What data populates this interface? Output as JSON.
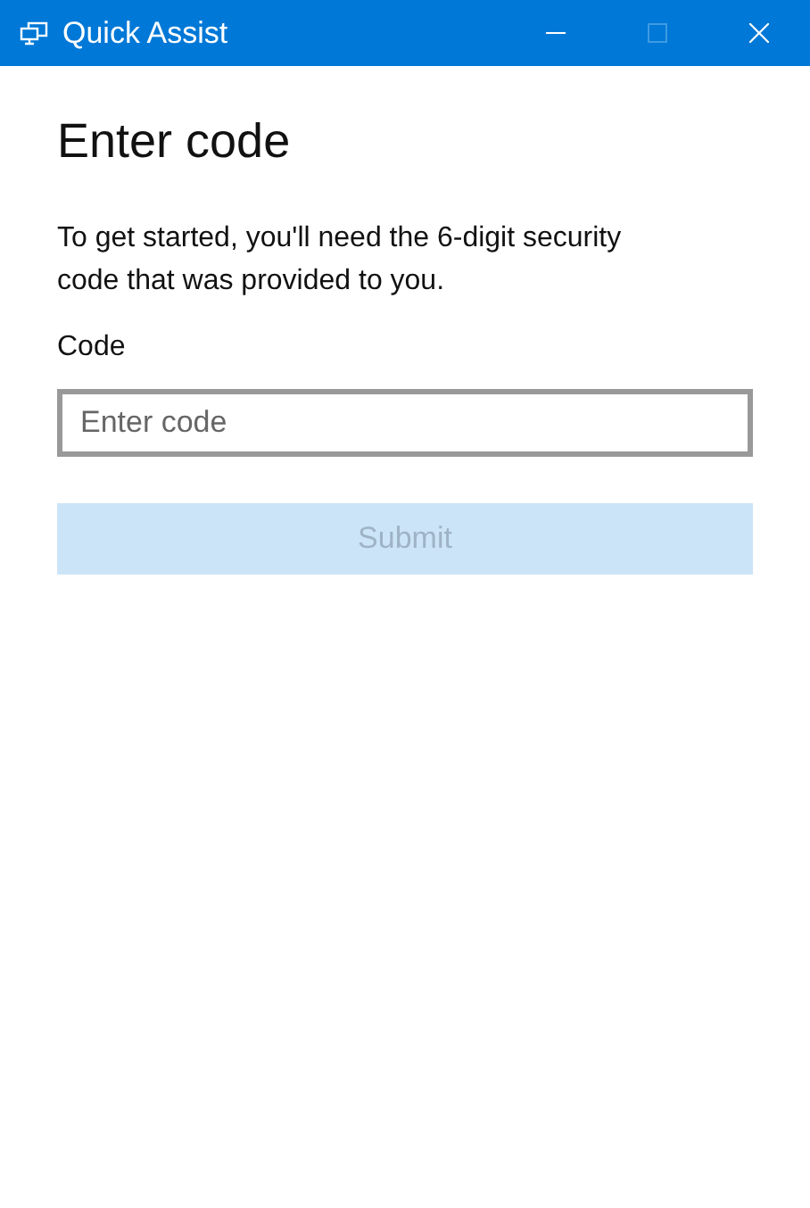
{
  "window": {
    "title": "Quick Assist",
    "controls": [
      {
        "kind": "minimize",
        "disabled": false
      },
      {
        "kind": "maximize",
        "disabled": true
      },
      {
        "kind": "close",
        "disabled": false
      }
    ]
  },
  "heading": "Enter code",
  "instructions": "To get started, you'll need the 6-digit security code that was provided to you.",
  "code_field": {
    "label": "Code",
    "placeholder": "Enter code"
  },
  "submit_button": {
    "label": "Submit",
    "disabled": true
  }
}
